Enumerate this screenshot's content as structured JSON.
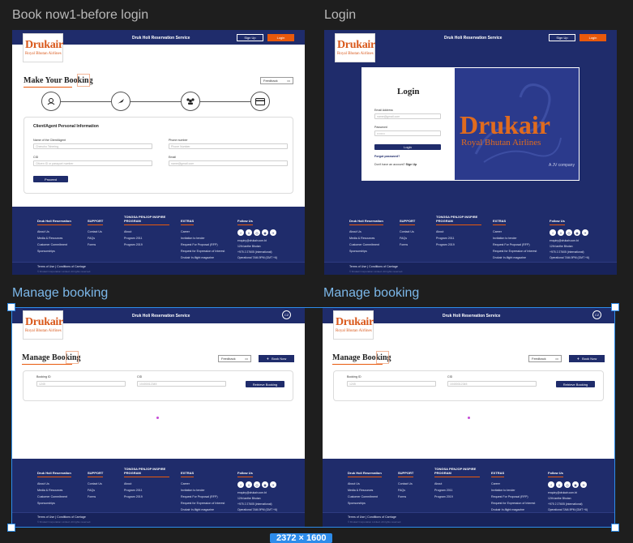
{
  "frame_labels": {
    "book_now": "Book now1-before login",
    "login": "Login",
    "manage_1": "Manage booking",
    "manage_2": "Manage booking"
  },
  "brand": {
    "logo_word": "Drukair",
    "logo_sub": "Royal Bhutan Airlines",
    "primary": "#1f2c6b",
    "accent": "#e8590c"
  },
  "nav": {
    "title": "Druk Holi Reservation Service",
    "signup": "Sign Up",
    "login": "Login",
    "avatar": "CZ"
  },
  "book_now": {
    "heading": "Make Your Booking",
    "feedback": "Feedback",
    "steps": [
      "user-icon",
      "plane-icon",
      "group-icon",
      "card-icon"
    ],
    "card_title": "Client/Agent Personal Information",
    "fields": [
      {
        "label": "Name of the Client/Agent",
        "placeholder": "Chencho Tshering"
      },
      {
        "label": "Phone number",
        "placeholder": "Phone Number"
      },
      {
        "label": "CID",
        "placeholder": "Citizen ID or passport number"
      },
      {
        "label": "Email",
        "placeholder": "name@gmail.com"
      }
    ],
    "proceed": "Proceed"
  },
  "login": {
    "heading": "Login",
    "email_label": "Email Address",
    "email_placeholder": "name@gmail.com",
    "password_label": "Password",
    "password_placeholder": "••••••••",
    "submit": "Login",
    "forgot": "Forgot password?",
    "no_account": "Don't have an account?",
    "signup_link": "Sign Up",
    "big_logo": "Drukair",
    "big_logo_sub": "Royal Bhutan Airlines",
    "tagline": "A JV company"
  },
  "manage": {
    "heading": "Manage Booking",
    "feedback": "Feedback",
    "book_now": "Book Now",
    "booking_id_label": "Booking ID",
    "booking_id_placeholder": "1245",
    "cid_label": "CID",
    "cid_placeholder": "10400012345",
    "retrieve": "Retrieve Booking"
  },
  "footer": {
    "col1_title": "Druk Holi Reservation",
    "col1_items": [
      "About Us",
      "Media & Resources",
      "Customer Commitment",
      "Sponsorships"
    ],
    "col2_title": "SUPPORT",
    "col2_items": [
      "Contact Us",
      "FAQs",
      "Forms"
    ],
    "col3_title": "TONGSA PENJOP INSPIRE PROGRAM",
    "col3_items": [
      "About",
      "Program 2011",
      "Program 2019"
    ],
    "col4_title": "EXTRAS",
    "col4_items": [
      "Career",
      "Invitation to tender",
      "Request For Proposal (RFP)",
      "Request for Expression of Interest",
      "Drukair In-flight magazine",
      "Duty Free Catalog"
    ],
    "col5_title": "Follow Us",
    "social": [
      "f",
      "X",
      "◎",
      "◉",
      "✈"
    ],
    "contact": [
      "enquiry@drukair.com.bt",
      "12th lanthe Bhutan",
      "+975 2 27605 (international)",
      "Operational 7AM-9PM (GMT +6)"
    ],
    "bottom_line": "Terms of Use | Conditions of Carriage",
    "copyright": "© Drukair Corporation Limited. All rights reserved."
  },
  "size_badge": "2372 × 1600"
}
